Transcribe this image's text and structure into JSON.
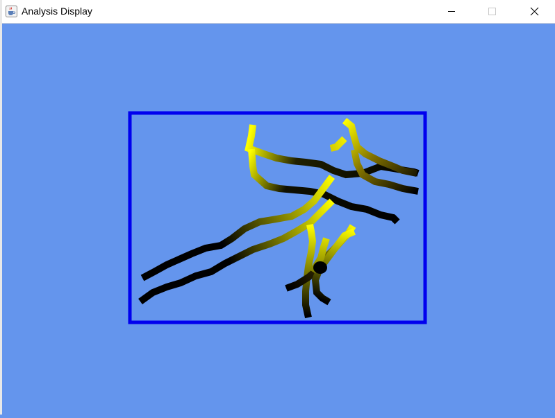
{
  "window": {
    "title": "Analysis Display",
    "app_icon": "java-coffee-icon",
    "controls": [
      "minimize-icon",
      "maximize-icon",
      "close-icon"
    ]
  },
  "colors": {
    "canvas_background": "#6495ED",
    "frame": "#0000EE",
    "stroke_start": "#000000",
    "stroke_end": "#FFFF00",
    "titlebar": "#FFFFFF"
  }
}
